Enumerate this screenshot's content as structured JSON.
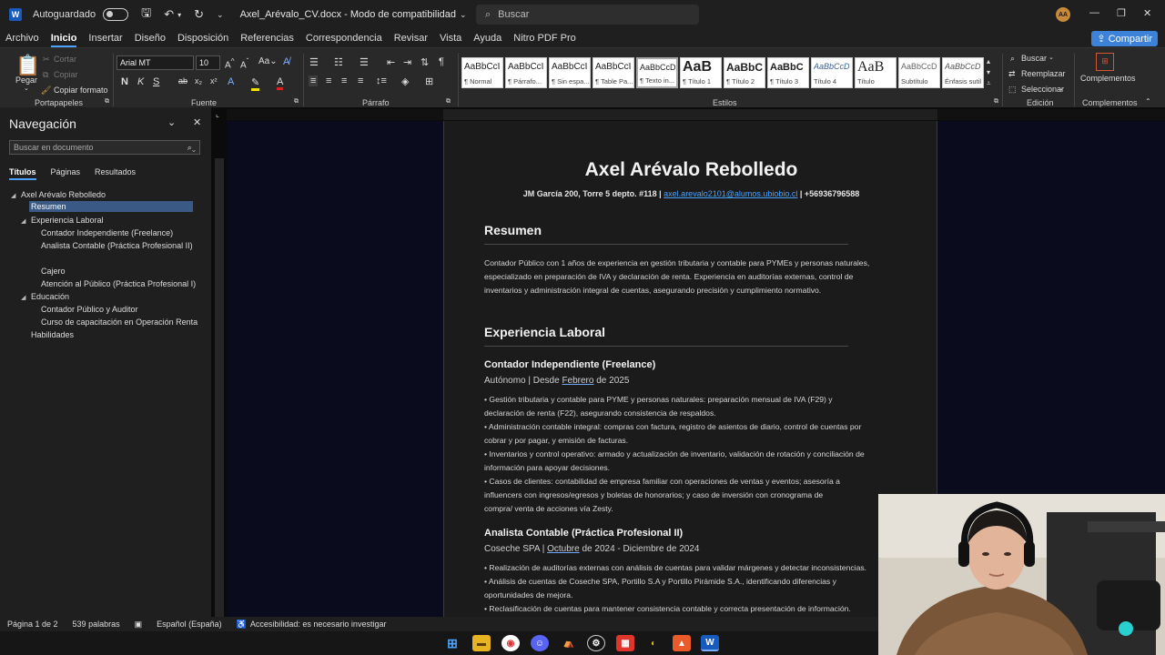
{
  "titlebar": {
    "autosave_label": "Autoguardado",
    "doc_title": "Axel_Arévalo_CV.docx  -  Modo de compatibilidad",
    "search_placeholder": "Buscar",
    "avatar_initials": "AA"
  },
  "menu": {
    "items": [
      "Archivo",
      "Inicio",
      "Insertar",
      "Diseño",
      "Disposición",
      "Referencias",
      "Correspondencia",
      "Revisar",
      "Vista",
      "Ayuda",
      "Nitro PDF Pro"
    ],
    "share_label": "Compartir"
  },
  "ribbon": {
    "clipboard": {
      "paste": "Pegar",
      "cut": "Cortar",
      "copy": "Copiar",
      "format_painter": "Copiar formato",
      "group": "Portapapeles"
    },
    "font": {
      "name": "Arial MT",
      "size": "10",
      "group": "Fuente"
    },
    "paragraph": {
      "group": "Párrafo"
    },
    "styles": {
      "group": "Estilos",
      "items": [
        {
          "sample": "AaBbCcI",
          "name": "¶ Normal"
        },
        {
          "sample": "AaBbCcI",
          "name": "¶ Párrafo..."
        },
        {
          "sample": "AaBbCcI",
          "name": "¶ Sin espa..."
        },
        {
          "sample": "AaBbCcI",
          "name": "¶ Table Pa..."
        },
        {
          "sample": "AaBbCcD",
          "name": "¶ Texto in..."
        },
        {
          "sample": "AaB",
          "name": "¶ Título 1"
        },
        {
          "sample": "AaBbC",
          "name": "¶ Título 2"
        },
        {
          "sample": "AaBbC",
          "name": "¶ Título 3"
        },
        {
          "sample": "AaBbCcD",
          "name": "Título 4"
        },
        {
          "sample": "AaB",
          "name": "Título"
        },
        {
          "sample": "AaBbCcD",
          "name": "Subtítulo"
        },
        {
          "sample": "AaBbCcD",
          "name": "Énfasis sutil"
        }
      ]
    },
    "editing": {
      "find": "Buscar",
      "replace": "Reemplazar",
      "select": "Seleccionar",
      "group": "Edición"
    },
    "addins": {
      "label": "Complementos",
      "group": "Complementos"
    }
  },
  "nav": {
    "title": "Navegación",
    "search_placeholder": "Buscar en documento",
    "tabs": [
      "Títulos",
      "Páginas",
      "Resultados"
    ],
    "tree": [
      "Axel Arévalo Rebolledo",
      "Resumen",
      "Experiencia Laboral",
      "Contador Independiente (Freelance)",
      "Analista Contable (Práctica Profesional II)",
      "Cajero",
      "Atención al Público (Práctica Profesional I)",
      "Educación",
      "Contador Público y Auditor",
      "Curso de capacitación en Operación Renta",
      "Habilidades"
    ]
  },
  "document": {
    "name": "Axel Arévalo Rebolledo",
    "contact_address": "JM García 200, Torre 5 depto. #118 | ",
    "contact_email": "axel.arevalo2101@alumos.ubiobio.cl",
    "contact_phone": " | +56936796588",
    "resumen_title": "Resumen",
    "resumen_lines": [
      "Contador Público con 1 años de experiencia en gestión tributaria y contable para PYMEs y personas naturales,",
      "especializado en preparación de IVA y declaración de renta. Experiencia en auditorías externas, control de",
      "inventarios y administración integral de cuentas, asegurando precisión y cumplimiento normativo."
    ],
    "exp_title": "Experiencia Laboral",
    "job1_title": "Contador Independiente (Freelance)",
    "job1_sub_a": "Autónomo | Desde ",
    "job1_sub_month": "Febrero",
    "job1_sub_b": " de 2025",
    "job1_lines": [
      "• Gestión tributaria y contable para PYME y personas naturales: preparación mensual de IVA (F29) y",
      "declaración de renta (F22), asegurando consistencia de respaldos.",
      "• Administración contable integral: compras con factura, registro de asientos de diario, control de cuentas por",
      "cobrar y por pagar, y emisión de facturas.",
      "• Inventarios y control operativo: armado y actualización de inventario, validación de rotación y conciliación de",
      "información para apoyar decisiones.",
      "• Casos de clientes: contabilidad de empresa familiar con operaciones de ventas y eventos; asesoría a",
      "influencers con ingresos/egresos y boletas de honorarios; y caso de inversión con cronograma de",
      "compra/ venta de acciones vía Zesty."
    ],
    "job2_title": "Analista Contable (Práctica Profesional II)",
    "job2_sub_a": "Coseche SPA | ",
    "job2_sub_month": "Octubre",
    "job2_sub_b": " de 2024 - Diciembre de 2024",
    "job2_lines": [
      "• Realización de auditorías externas con análisis de cuentas para validar márgenes y detectar inconsistencias.",
      "• Análisis de cuentas de Coseche SPA, Portillo S.A y Portillo Pirámide S.A., identificando diferencias y",
      "oportunidades de mejora.",
      "• Reclasificación de cuentas para mantener consistencia contable y correcta presentación de información."
    ]
  },
  "status": {
    "page": "Página 1 de 2",
    "words": "539 palabras",
    "language": "Español (España)",
    "accessibility": "Accesibilidad: es necesario investigar"
  },
  "colors": {
    "accent": "#4ea0ff",
    "word_blue": "#185abd",
    "link": "#4aa3ff",
    "canvas": "#0a0c1e"
  }
}
